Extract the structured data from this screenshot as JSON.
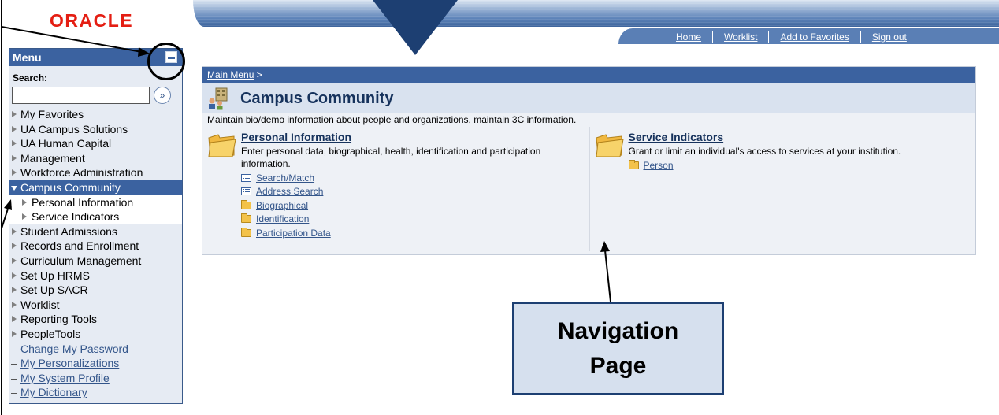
{
  "header": {
    "logo_text": "ORACLE",
    "brand_color": "#e41e13",
    "nav_links": [
      "Home",
      "Worklist",
      "Add to Favorites",
      "Sign out"
    ]
  },
  "menu": {
    "title": "Menu",
    "search_label": "Search:",
    "search_value": "",
    "items": [
      {
        "label": "My Favorites",
        "type": "folder"
      },
      {
        "label": "UA Campus Solutions",
        "type": "folder"
      },
      {
        "label": "UA Human Capital",
        "type": "folder"
      },
      {
        "label": "Management",
        "type": "continuation"
      },
      {
        "label": "Workforce Administration",
        "type": "folder"
      },
      {
        "label": "Campus Community",
        "type": "selected"
      },
      {
        "label": "Personal Information",
        "type": "sub"
      },
      {
        "label": "Service Indicators",
        "type": "sub"
      },
      {
        "label": "Student Admissions",
        "type": "folder"
      },
      {
        "label": "Records and Enrollment",
        "type": "folder"
      },
      {
        "label": "Curriculum Management",
        "type": "folder"
      },
      {
        "label": "Set Up HRMS",
        "type": "folder"
      },
      {
        "label": "Set Up SACR",
        "type": "folder"
      },
      {
        "label": "Worklist",
        "type": "folder"
      },
      {
        "label": "Reporting Tools",
        "type": "folder"
      },
      {
        "label": "PeopleTools",
        "type": "folder"
      },
      {
        "label": "Change My Password",
        "type": "link"
      },
      {
        "label": "My Personalizations",
        "type": "link"
      },
      {
        "label": "My System Profile",
        "type": "link"
      },
      {
        "label": "My Dictionary",
        "type": "link"
      }
    ]
  },
  "content": {
    "breadcrumb_link": "Main Menu",
    "breadcrumb_sep": ">",
    "page_title": "Campus Community",
    "description": "Maintain bio/demo information about people and organizations, maintain 3C information.",
    "sections": [
      {
        "title": "Personal Information",
        "description": "Enter personal data, biographical, health, identification and participation information.",
        "links": [
          {
            "label": "Search/Match",
            "icon": "component-icon"
          },
          {
            "label": "Address Search",
            "icon": "component-icon"
          },
          {
            "label": "Biographical",
            "icon": "folder-icon"
          },
          {
            "label": "Identification",
            "icon": "folder-icon"
          },
          {
            "label": "Participation Data",
            "icon": "folder-icon"
          }
        ]
      },
      {
        "title": "Service Indicators",
        "description": "Grant or limit an individual's access to services at your institution.",
        "links": [
          {
            "label": "Person",
            "icon": "folder-icon"
          }
        ]
      }
    ]
  },
  "callout": {
    "line1": "Navigation",
    "line2": "Page"
  }
}
